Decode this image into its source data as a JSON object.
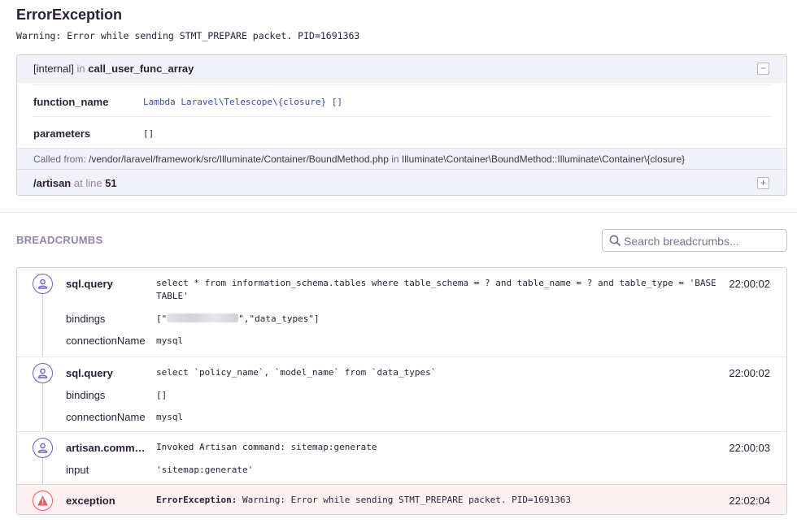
{
  "exception": {
    "title": "ErrorException",
    "message": "Warning: Error while sending STMT_PREPARE packet. PID=1691363"
  },
  "frame": {
    "internal": "[internal]",
    "in_word": "in",
    "function": "call_user_func_array",
    "collapse_symbol": "−",
    "vars": [
      {
        "key": "function_name",
        "value": "Lambda Laravel\\Telescope\\{closure} []"
      },
      {
        "key": "parameters",
        "value": "[]"
      }
    ],
    "called_from_label": "Called from:",
    "called_from_path": "/vendor/laravel/framework/src/Illuminate/Container/BoundMethod.php",
    "called_from_in": "in",
    "called_from_func": "Illuminate\\Container\\BoundMethod::Illuminate\\Container\\{closure}"
  },
  "frame2": {
    "file": "/artisan",
    "at_line_label": "at line",
    "line": "51",
    "expand_symbol": "+"
  },
  "breadcrumbs": {
    "heading": "BREADCRUMBS",
    "search_placeholder": "Search breadcrumbs...",
    "items": [
      {
        "category": "sql.query",
        "message": "select * from information_schema.tables where table_schema = ? and table_name = ? and table_type = 'BASE TABLE'",
        "time": "22:00:02",
        "data": [
          {
            "key": "bindings",
            "value_prefix": "[\"",
            "value_suffix": "\",\"data_types\"]"
          },
          {
            "key": "connectionName",
            "value": "mysql"
          }
        ]
      },
      {
        "category": "sql.query",
        "message": "select `policy_name`, `model_name` from `data_types`",
        "time": "22:00:02",
        "data": [
          {
            "key": "bindings",
            "value": "[]"
          },
          {
            "key": "connectionName",
            "value": "mysql"
          }
        ]
      },
      {
        "category": "artisan.comma...",
        "message": "Invoked Artisan command: sitemap:generate",
        "time": "22:00:03",
        "data": [
          {
            "key": "input",
            "value": "'sitemap:generate'"
          }
        ]
      },
      {
        "category": "exception",
        "message_bold": "ErrorException:",
        "message": "Warning: Error while sending STMT_PREPARE packet. PID=1691363",
        "time": "22:02:04"
      }
    ]
  },
  "colors": {
    "accent": "#6c5fc7",
    "error": "#f55459",
    "text": "#2b1d38",
    "muted": "#9585a3",
    "value_blue": "#3b4ba8"
  }
}
